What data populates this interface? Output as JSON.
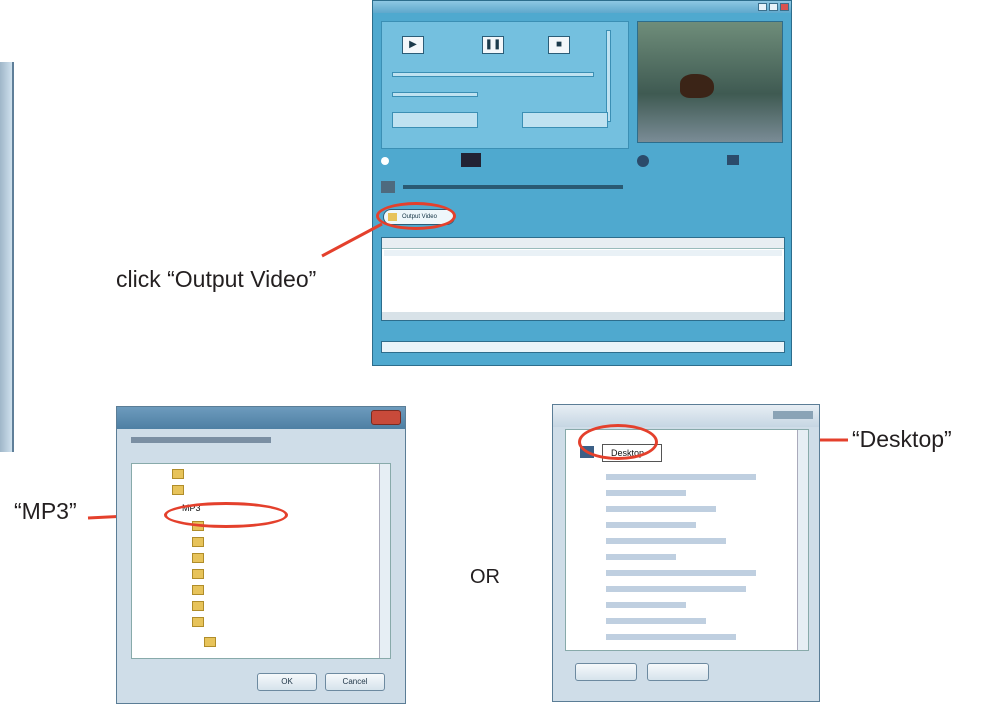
{
  "callouts": {
    "output_video": "click “Output Video”",
    "mp3": "“MP3”",
    "desktop": "“Desktop”",
    "or": "OR"
  },
  "app_window": {
    "output_button_label": "Output Video"
  },
  "browse_dialog_1": {
    "buttons": {
      "ok": "OK",
      "cancel": "Cancel"
    },
    "tree_items": [
      {
        "label": ""
      },
      {
        "label": ""
      },
      {
        "label": "MP3"
      },
      {
        "label": ""
      },
      {
        "label": ""
      },
      {
        "label": ""
      },
      {
        "label": ""
      },
      {
        "label": ""
      },
      {
        "label": ""
      },
      {
        "label": ""
      },
      {
        "label": ""
      }
    ]
  },
  "browse_dialog_2": {
    "selected_item": "Desktop"
  },
  "colors": {
    "annotation": "#e4402c",
    "app_background": "#4fa9cf"
  }
}
